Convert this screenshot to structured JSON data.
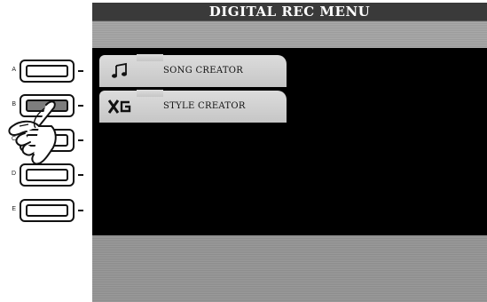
{
  "screen": {
    "title": "DIGITAL REC MENU"
  },
  "menu": {
    "items": [
      {
        "label": "SONG CREATOR",
        "icon": "music-note-icon"
      },
      {
        "label": "STYLE CREATOR",
        "icon": "xg-logo-icon"
      }
    ]
  },
  "panel_buttons": [
    {
      "letter": "A",
      "pressed": false
    },
    {
      "letter": "B",
      "pressed": true
    },
    {
      "letter": "C",
      "pressed": false
    },
    {
      "letter": "D",
      "pressed": false
    },
    {
      "letter": "E",
      "pressed": false
    }
  ],
  "colors": {
    "screen_bg": "#000000",
    "tab_bg": "#d0d0d0",
    "band": "#a0a0a0",
    "pressed_button": "#7d7d7d"
  }
}
